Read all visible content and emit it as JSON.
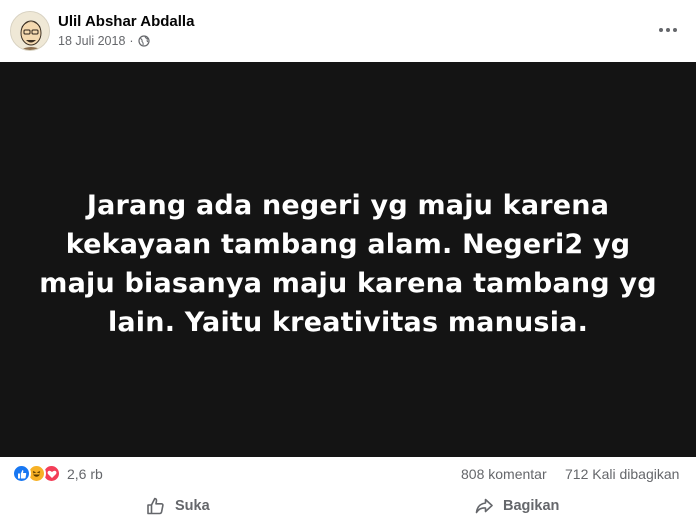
{
  "post": {
    "author": "Ulil Abshar Abdalla",
    "date": "18 Juli 2018",
    "separator": "·",
    "audience_icon": "globe-icon",
    "image_text": "Jarang ada negeri yg maju karena kekayaan tambang alam. Negeri2 yg maju biasanya maju karena tambang yg lain. Yaitu kreativitas manusia."
  },
  "stats": {
    "reactions_count": "2,6 rb",
    "reaction_icons": [
      "like-icon",
      "haha-icon",
      "love-icon"
    ],
    "comments": "808 komentar",
    "shares": "712 Kali dibagikan"
  },
  "actions": {
    "like_label": "Suka",
    "share_label": "Bagikan"
  },
  "colors": {
    "image_background": "#141414",
    "like": "#1877f2",
    "haha": "#f7b125",
    "love": "#f33e58",
    "secondary_text": "#65676b"
  }
}
